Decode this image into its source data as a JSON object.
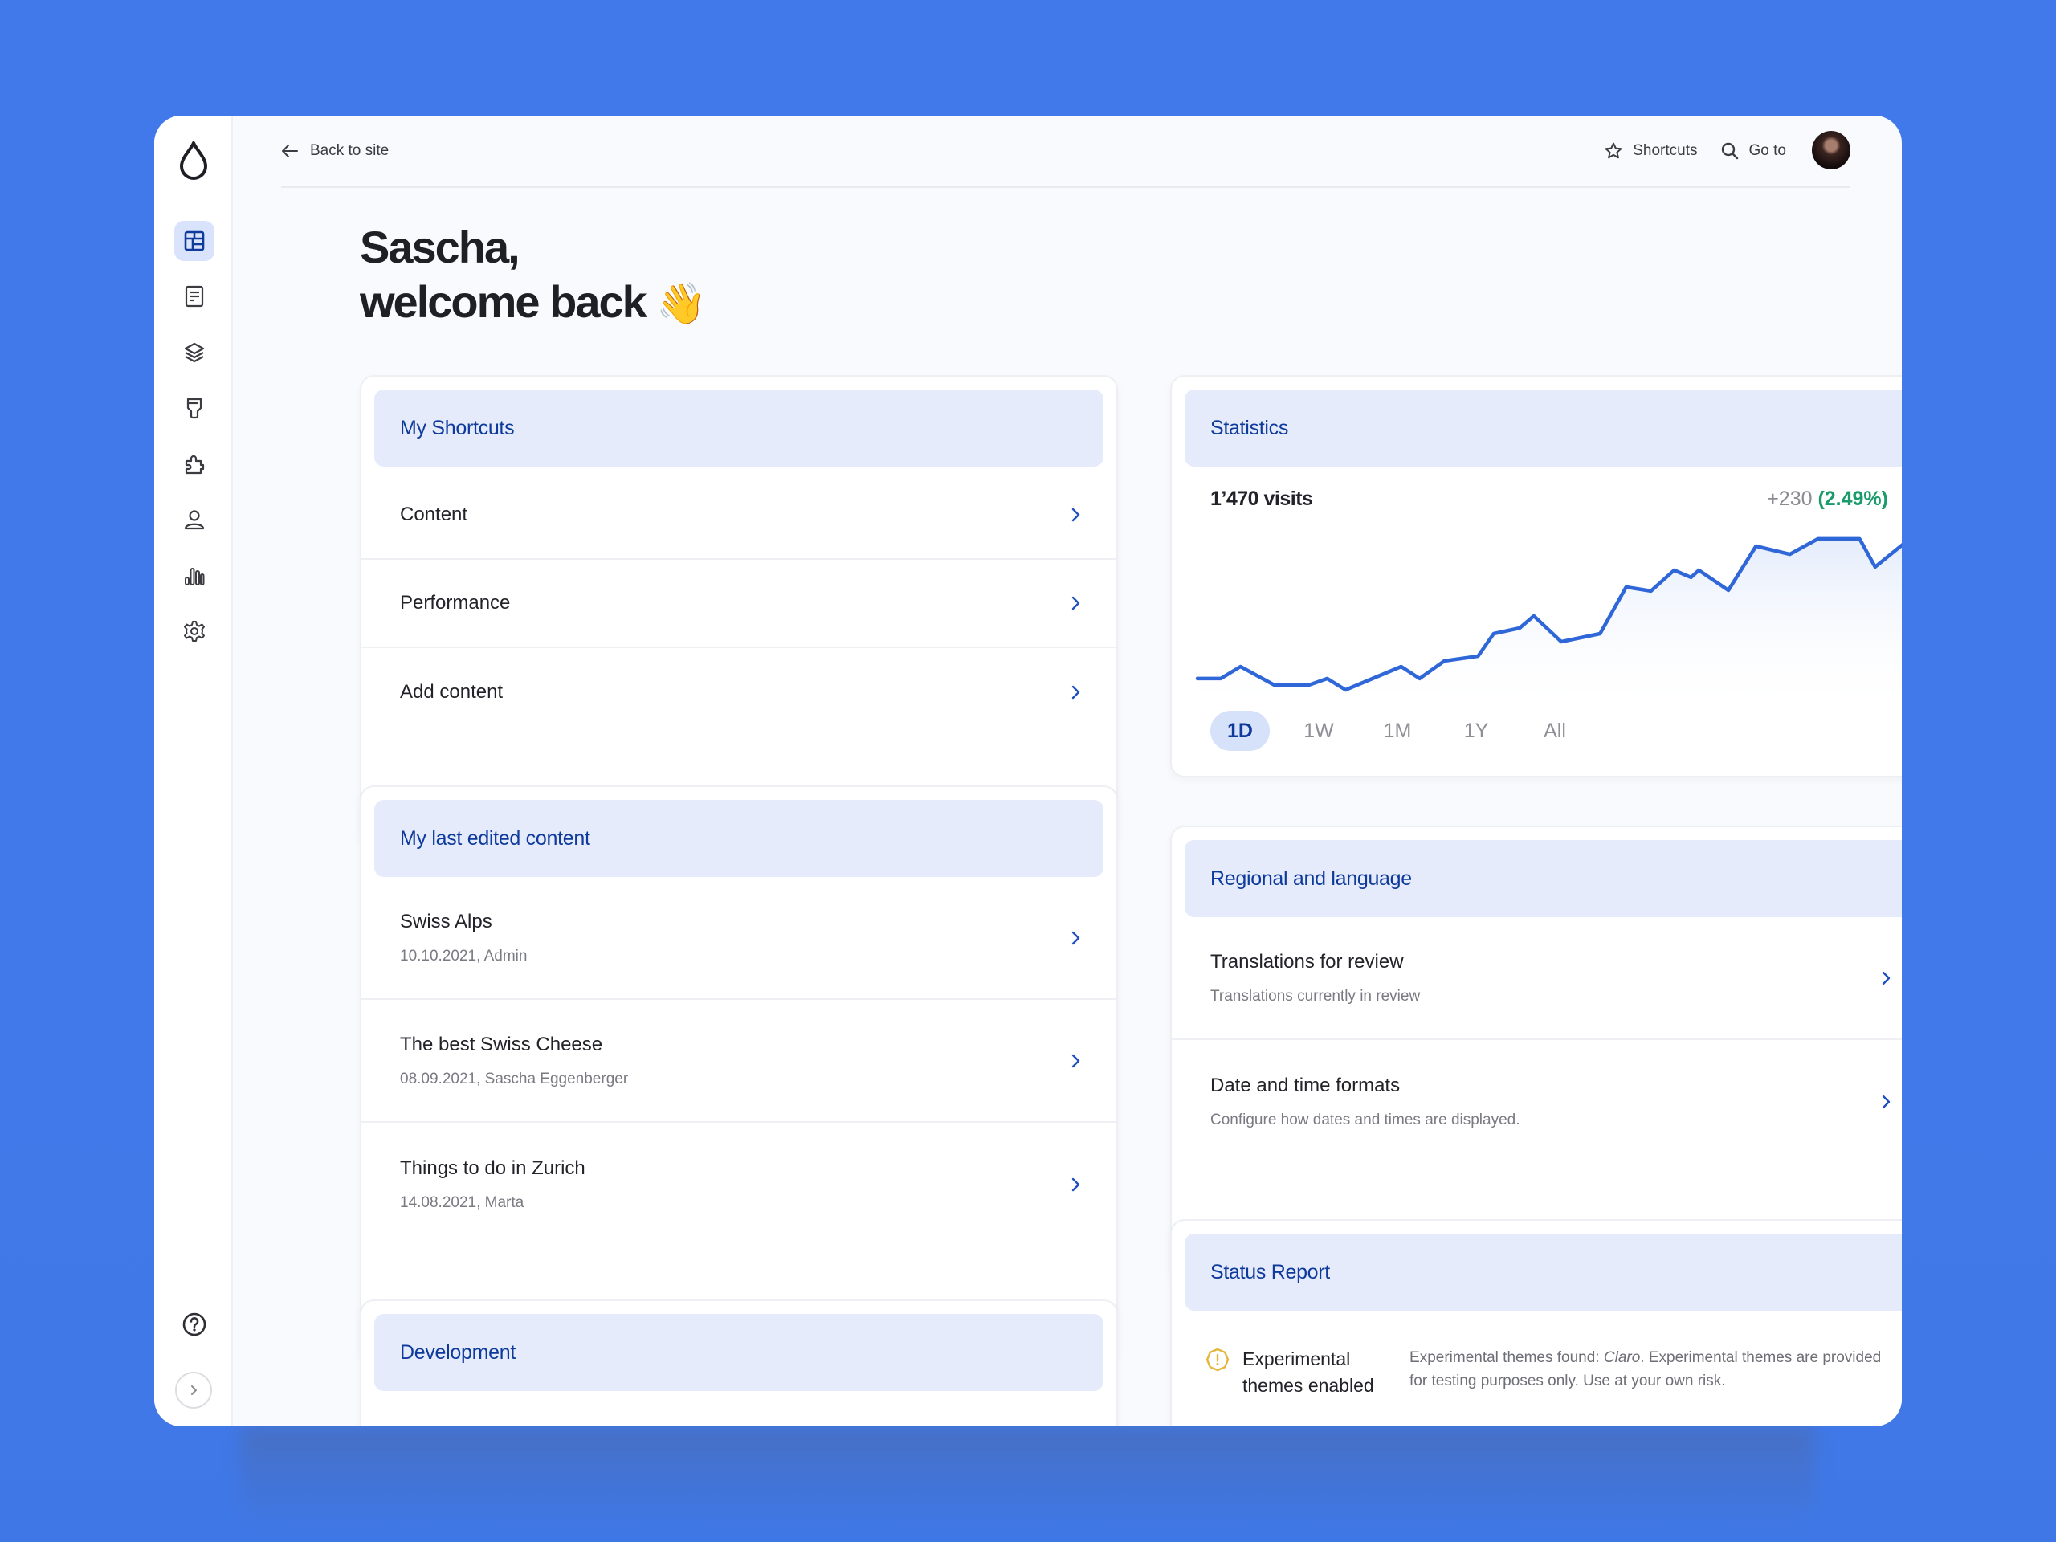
{
  "sidebar": {
    "logo": "drupal-drop-icon",
    "items": [
      {
        "icon": "dashboard-icon",
        "label": "Dashboard",
        "active": true
      },
      {
        "icon": "content-icon",
        "label": "Content",
        "active": false
      },
      {
        "icon": "structure-layers-icon",
        "label": "Structure",
        "active": false
      },
      {
        "icon": "appearance-brush-icon",
        "label": "Appearance",
        "active": false
      },
      {
        "icon": "extend-puzzle-icon",
        "label": "Extend",
        "active": false
      },
      {
        "icon": "people-icon",
        "label": "People",
        "active": false
      },
      {
        "icon": "reports-chart-icon",
        "label": "Reports",
        "active": false
      },
      {
        "icon": "configuration-gear-icon",
        "label": "Configuration",
        "active": false
      }
    ],
    "help_icon": "help-icon",
    "expand_icon": "chevron-right-icon"
  },
  "topbar": {
    "back_label": "Back to site",
    "shortcuts_label": "Shortcuts",
    "goto_label": "Go to"
  },
  "greeting": {
    "line1": "Sascha,",
    "line2": "welcome back",
    "emoji": "👋"
  },
  "shortcuts": {
    "title": "My Shortcuts",
    "items": [
      {
        "label": "Content"
      },
      {
        "label": "Performance"
      },
      {
        "label": "Add content"
      }
    ]
  },
  "last_edited": {
    "title": "My last edited content",
    "items": [
      {
        "title": "Swiss Alps",
        "meta": "10.10.2021, Admin"
      },
      {
        "title": "The best Swiss Cheese",
        "meta": "08.09.2021, Sascha Eggenberger"
      },
      {
        "title": "Things to do in Zurich",
        "meta": "14.08.2021, Marta"
      }
    ]
  },
  "development": {
    "title": "Development"
  },
  "statistics": {
    "title": "Statistics",
    "visits": "1’470 visits",
    "delta_abs": "+230",
    "delta_pct": "(2.49%)",
    "ranges": [
      "1D",
      "1W",
      "1M",
      "1Y",
      "All"
    ],
    "active_range": "1D"
  },
  "regional": {
    "title": "Regional and language",
    "items": [
      {
        "title": "Translations for review",
        "desc": "Translations currently in review"
      },
      {
        "title": "Date and time formats",
        "desc": "Configure how dates and times are displayed."
      }
    ]
  },
  "status_report": {
    "title": "Status Report",
    "items": [
      {
        "severity": "warning",
        "title": "Experimental themes enabled",
        "desc_prefix": "Experimental themes found: ",
        "desc_theme": "Claro",
        "desc_suffix": ". Experimental themes are provided for testing purposes only. Use at your own risk."
      }
    ]
  },
  "colors": {
    "background": "#4279ea",
    "accent": "#0d3a9b",
    "line": "#2f67d8",
    "positive": "#1a9b6a",
    "warning": "#e3b63c"
  },
  "chart_data": {
    "type": "area",
    "title": "Statistics",
    "xlabel": "",
    "ylabel": "",
    "note": "No axes shown; x and y are relative (0-100) positions within the plotted range",
    "x": [
      0,
      3.3,
      6.1,
      10.9,
      15.8,
      18.4,
      21,
      28.9,
      31.5,
      35,
      39.8,
      42,
      45.7,
      47.7,
      51.6,
      57.1,
      60.8,
      64.3,
      67.6,
      70,
      71.1,
      75.3,
      79.2,
      84,
      88,
      93.9,
      96.1,
      100
    ],
    "series": [
      {
        "name": "visits",
        "values": [
          16.3,
          16.3,
          22.5,
          12.9,
          12.9,
          16.3,
          10.4,
          22.5,
          16.3,
          25.4,
          27.9,
          39.6,
          42.5,
          48.8,
          35.4,
          39.6,
          63.8,
          61.7,
          72.5,
          68.8,
          72.5,
          62.1,
          85.0,
          80.8,
          88.8,
          88.8,
          74.2,
          85.8
        ]
      }
    ],
    "xlim": [
      0,
      100
    ],
    "ylim": [
      0,
      100
    ],
    "grid": false,
    "legend": "none"
  }
}
